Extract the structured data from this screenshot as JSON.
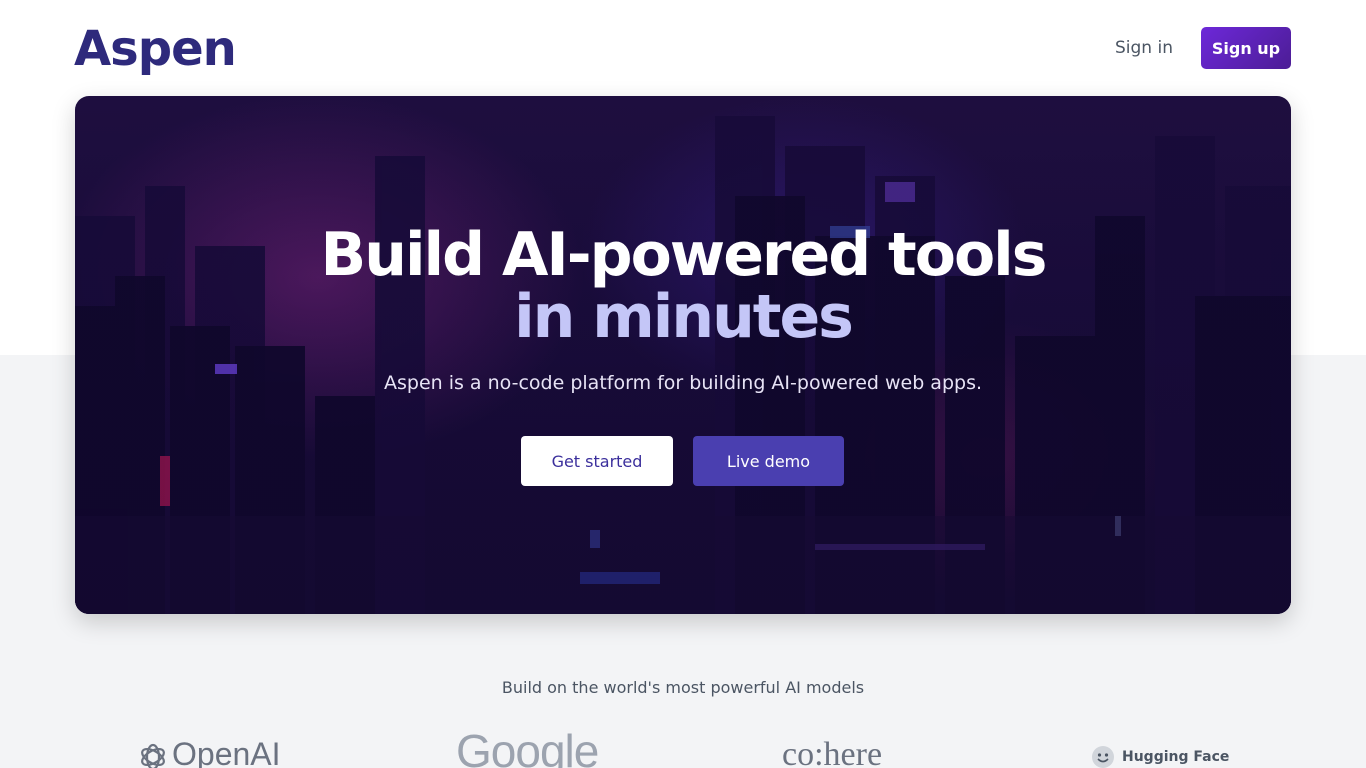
{
  "header": {
    "logo": "Aspen",
    "signin_label": "Sign in",
    "signup_label": "Sign up"
  },
  "hero": {
    "headline_line1": "Build AI-powered tools",
    "headline_line2": "in minutes",
    "subtitle": "Aspen is a no-code platform for building AI-powered web apps.",
    "primary_button": "Get started",
    "secondary_button": "Live demo"
  },
  "models": {
    "title": "Build on the world's most powerful AI models",
    "brands": [
      {
        "name": "OpenAI",
        "icon": "openai-icon"
      },
      {
        "name": "Google",
        "icon": ""
      },
      {
        "name": "co:here",
        "icon": ""
      },
      {
        "name": "Hugging Face",
        "icon": "hugging-face-icon"
      }
    ]
  },
  "colors": {
    "brand": "#2e2a7c",
    "signup_bg": "#6d28d9",
    "demo_bg": "#4a3fb0",
    "headline_accent": "#c4c6f7",
    "page_bg_lower": "#f3f4f6"
  }
}
